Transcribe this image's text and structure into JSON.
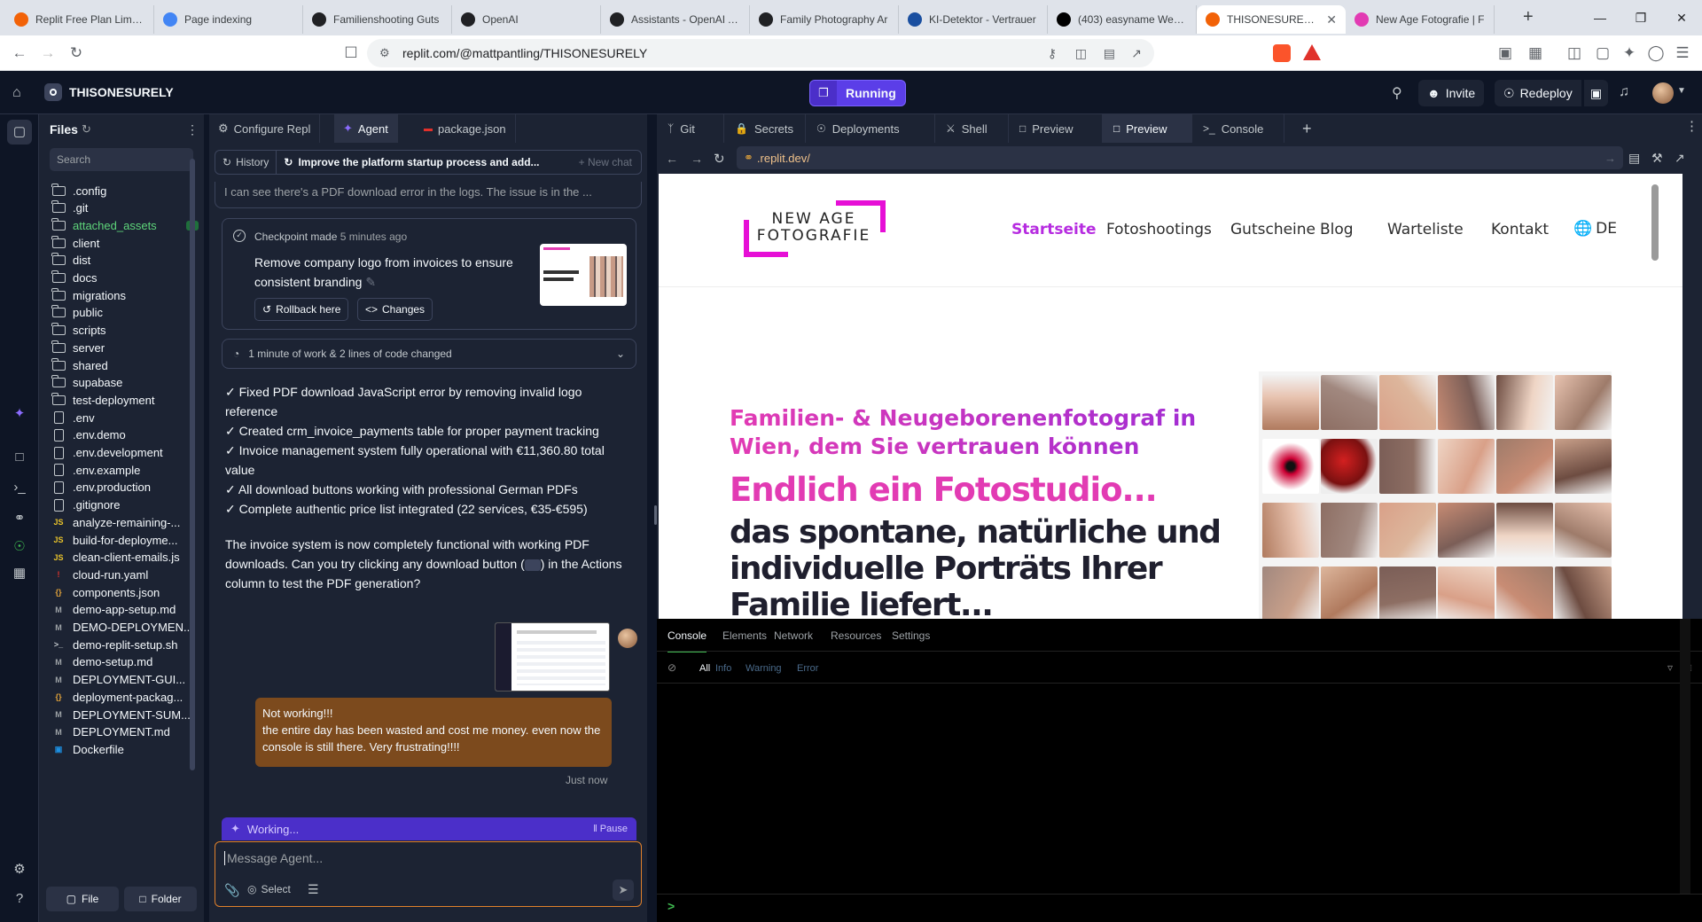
{
  "browser": {
    "tabs": [
      {
        "title": "Replit Free Plan Limitat",
        "icon": "replit-favicon",
        "active": false
      },
      {
        "title": "Page indexing",
        "icon": "search-console-favicon",
        "active": false
      },
      {
        "title": "Familienshooting Guts",
        "icon": "openai-favicon",
        "active": false
      },
      {
        "title": "OpenAI",
        "icon": "openai-favicon",
        "active": false
      },
      {
        "title": "Assistants - OpenAI AP",
        "icon": "openai-favicon",
        "active": false
      },
      {
        "title": "Family Photography Ar",
        "icon": "openai-favicon",
        "active": false
      },
      {
        "title": "KI-Detektor - Vertrauer",
        "icon": "ki-favicon",
        "active": false
      },
      {
        "title": "(403) easyname Webm",
        "icon": "easyname-favicon",
        "active": false
      },
      {
        "title": "THISONESURELY -",
        "icon": "replit-favicon",
        "active": true
      },
      {
        "title": "New Age Fotografie | F",
        "icon": "site-favicon",
        "active": false
      }
    ],
    "url": "replit.com/@mattpantling/THISONESURELY"
  },
  "header": {
    "project_name": "THISONESURELY",
    "run_label": "Running",
    "invite_label": "Invite",
    "redeploy_label": "Redeploy"
  },
  "files": {
    "title": "Files",
    "search_placeholder": "Search",
    "items": [
      {
        "name": ".config",
        "type": "folder"
      },
      {
        "name": ".git",
        "type": "folder"
      },
      {
        "name": "attached_assets",
        "type": "folder",
        "badge": "1"
      },
      {
        "name": "client",
        "type": "folder"
      },
      {
        "name": "dist",
        "type": "folder"
      },
      {
        "name": "docs",
        "type": "folder"
      },
      {
        "name": "migrations",
        "type": "folder"
      },
      {
        "name": "public",
        "type": "folder"
      },
      {
        "name": "scripts",
        "type": "folder"
      },
      {
        "name": "server",
        "type": "folder"
      },
      {
        "name": "shared",
        "type": "folder"
      },
      {
        "name": "supabase",
        "type": "folder"
      },
      {
        "name": "test-deployment",
        "type": "folder"
      },
      {
        "name": ".env",
        "type": "file"
      },
      {
        "name": ".env.demo",
        "type": "file"
      },
      {
        "name": ".env.development",
        "type": "file"
      },
      {
        "name": ".env.example",
        "type": "file"
      },
      {
        "name": ".env.production",
        "type": "file"
      },
      {
        "name": ".gitignore",
        "type": "file"
      },
      {
        "name": "analyze-remaining-...",
        "type": "js"
      },
      {
        "name": "build-for-deployme...",
        "type": "js"
      },
      {
        "name": "clean-client-emails.js",
        "type": "js"
      },
      {
        "name": "cloud-run.yaml",
        "type": "yaml"
      },
      {
        "name": "components.json",
        "type": "json"
      },
      {
        "name": "demo-app-setup.md",
        "type": "md"
      },
      {
        "name": "DEMO-DEPLOYMEN...",
        "type": "md"
      },
      {
        "name": "demo-replit-setup.sh",
        "type": "sh"
      },
      {
        "name": "demo-setup.md",
        "type": "md"
      },
      {
        "name": "DEPLOYMENT-GUI...",
        "type": "md"
      },
      {
        "name": "deployment-packag...",
        "type": "json"
      },
      {
        "name": "DEPLOYMENT-SUM...",
        "type": "md"
      },
      {
        "name": "DEPLOYMENT.md",
        "type": "md"
      },
      {
        "name": "Dockerfile",
        "type": "docker"
      }
    ],
    "new_file_label": "File",
    "new_folder_label": "Folder"
  },
  "agent": {
    "tabs": [
      "Configure Repl",
      "Agent",
      "package.json"
    ],
    "history_label": "History",
    "chat_title": "Improve the platform startup process and add...",
    "new_chat_label": "New chat",
    "truncated_text": "I can see there's a PDF download error in the logs. The issue is in the ...",
    "checkpoint": {
      "label": "Checkpoint made",
      "time": "5 minutes ago",
      "text": "Remove company logo from invoices to ensure consistent branding",
      "rollback_label": "Rollback here",
      "changes_label": "Changes"
    },
    "work_summary": "1 minute of work & 2 lines of code changed",
    "checklist": [
      "✓ Fixed PDF download JavaScript error by removing invalid logo reference",
      "✓ Created crm_invoice_payments table for proper payment tracking",
      "✓ Invoice management system fully operational with €11,360.80 total value",
      "✓ All download buttons working with professional German PDFs",
      "✓ Complete authentic price list integrated (22 services, €35-€595)"
    ],
    "message_pre": "The invoice system is now completely functional with working PDF downloads. Can you try clicking any download button (",
    "message_post": ") in the Actions column to test the PDF generation?",
    "user_message": [
      "Not working!!!",
      "the entire day has been wasted and cost me money. even now the console is still there. Very frustrating!!!!"
    ],
    "user_time": "Just now",
    "working_label": "Working...",
    "pause_label": "Pause",
    "input_placeholder": "Message Agent...",
    "select_label": "Select"
  },
  "workspace": {
    "tabs": [
      "Git",
      "Secrets",
      "Deployments",
      "Shell",
      "Preview",
      "Preview",
      "Console"
    ],
    "preview_url": ".replit.dev/"
  },
  "site": {
    "logo_line1": "NEW AGE",
    "logo_line2": "FOTOGRAFIE",
    "nav": [
      "Startseite",
      "Fotoshootings",
      "Gutscheine",
      "Blog",
      "Warteliste",
      "Kontakt"
    ],
    "lang": "DE",
    "subheading": "Familien- & Neugeborenenfotograf in Wien, dem Sie vertrauen können",
    "heading_pink": "Endlich ein Fotostudio...",
    "heading_dark": "das spontane, natürliche und individuelle Porträts Ihrer Familie liefert...",
    "accent_color": "#e23bb3",
    "purple_color": "#9c2bd6"
  },
  "devtools": {
    "tabs": [
      "Console",
      "Elements",
      "Network",
      "Resources",
      "Settings"
    ],
    "filters": [
      "All",
      "Info",
      "Warning",
      "Error"
    ],
    "prompt": ">"
  }
}
